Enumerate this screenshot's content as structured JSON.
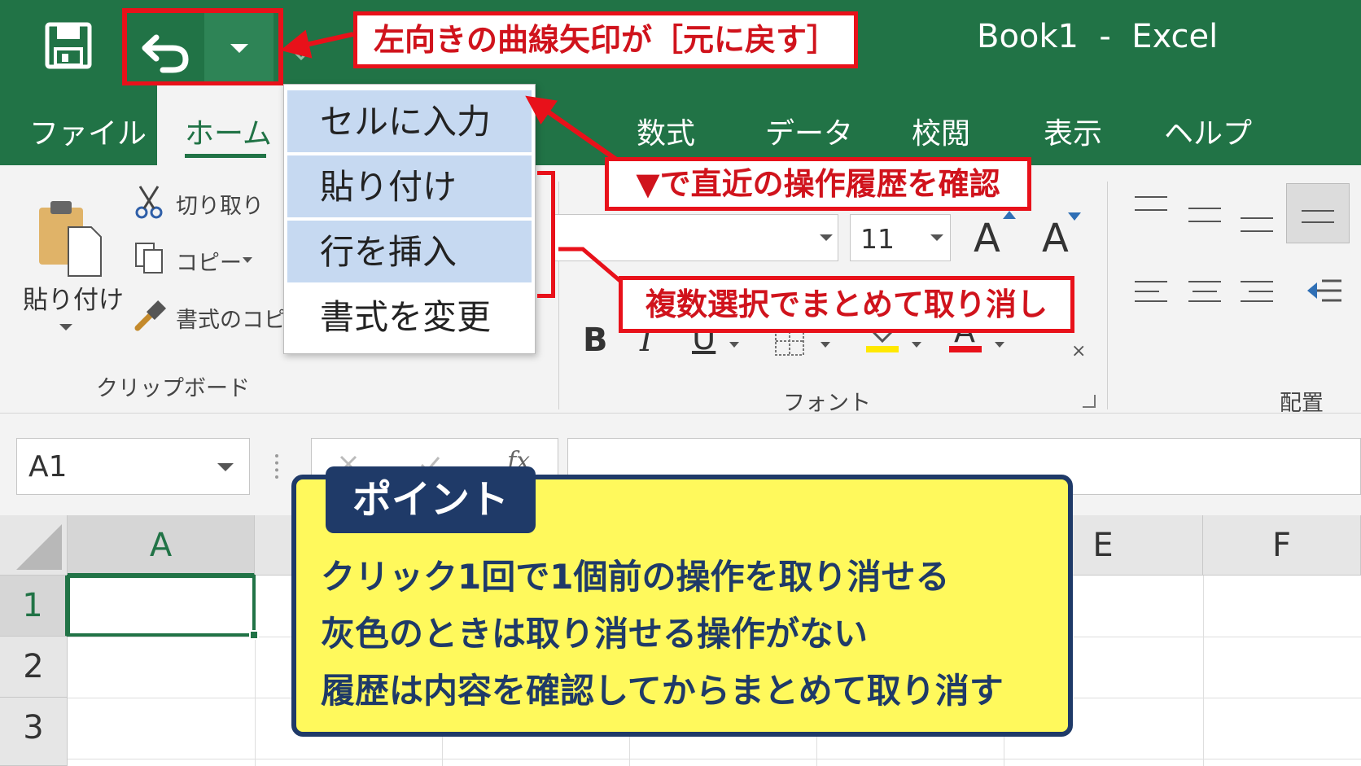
{
  "window": {
    "title": "Book1  -  Excel"
  },
  "tabs": [
    {
      "label": "ファイル",
      "active": false
    },
    {
      "label": "ホーム",
      "active": true
    },
    {
      "label": "数式",
      "active": false
    },
    {
      "label": "データ",
      "active": false
    },
    {
      "label": "校閲",
      "active": false
    },
    {
      "label": "表示",
      "active": false
    },
    {
      "label": "ヘルプ",
      "active": false
    }
  ],
  "clipboard": {
    "paste_label": "貼り付け",
    "cut_label": "切り取り",
    "copy_label": "コピー",
    "format_painter_label": "書式のコピー",
    "group_label": "クリップボード"
  },
  "font": {
    "size_value": "11",
    "bold": "B",
    "italic": "I",
    "underline": "U",
    "grow": "A",
    "shrink": "A",
    "font_color": "A",
    "group_label": "フォント"
  },
  "alignment": {
    "group_label": "配置"
  },
  "formula_bar": {
    "name_box": "A1"
  },
  "grid": {
    "columns": [
      "A",
      "E",
      "F"
    ],
    "rows": [
      "1",
      "2",
      "3"
    ]
  },
  "undo_menu": {
    "items": [
      {
        "label": "セルに入力",
        "selected": true
      },
      {
        "label": "貼り付け",
        "selected": true
      },
      {
        "label": "行を挿入",
        "selected": true
      },
      {
        "label": "書式を変更",
        "selected": false
      }
    ]
  },
  "annotations": {
    "callout_undo": "左向きの曲線矢印が［元に戻す］",
    "callout_history": "▼で直近の操作履歴を確認",
    "callout_multi": "複数選択でまとめて取り消し"
  },
  "point": {
    "tag": "ポイント",
    "lines": [
      "クリック1回で1個前の操作を取り消せる",
      "灰色のときは取り消せる操作がない",
      "履歴は内容を確認してからまとめて取り消す"
    ]
  },
  "colors": {
    "excel_green": "#217346",
    "annotation_red": "#e8111a",
    "point_yellow": "#fff95c",
    "point_navy": "#1f3a68",
    "menu_selected": "#c6d9f1"
  }
}
